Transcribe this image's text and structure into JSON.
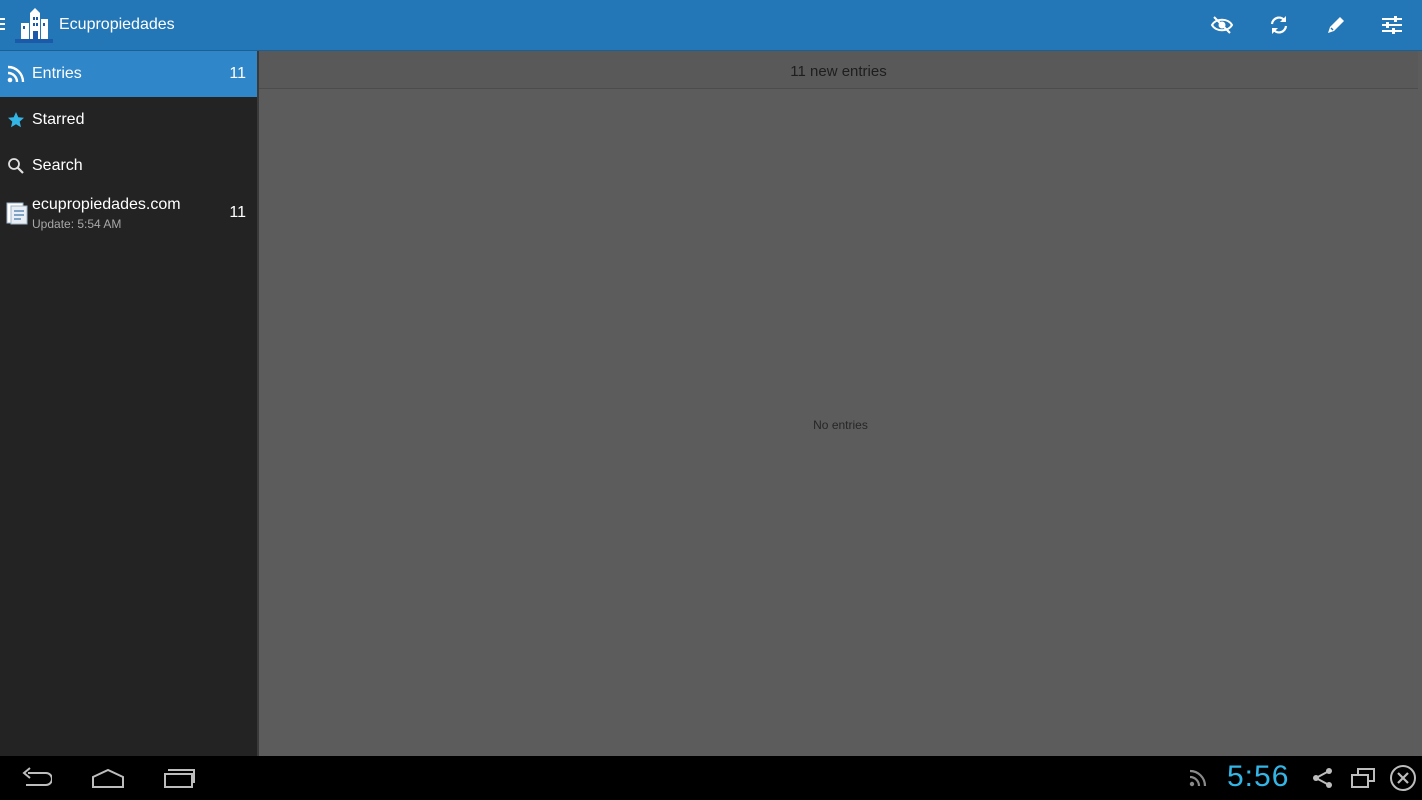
{
  "actionbar": {
    "title": "Ecupropiedades",
    "logo_icon": "building-logo-icon",
    "actions": [
      "hide-read-icon",
      "refresh-icon",
      "edit-icon",
      "settings-sliders-icon"
    ],
    "accent_color": "#2377b6"
  },
  "sidebar": {
    "items": [
      {
        "icon": "rss-icon",
        "label": "Entries",
        "count": "11",
        "active": true
      },
      {
        "icon": "star-icon",
        "label": "Starred",
        "count": ""
      },
      {
        "icon": "search-icon",
        "label": "Search",
        "count": ""
      }
    ],
    "feeds": [
      {
        "icon": "feed-document-icon",
        "title": "ecupropiedades.com",
        "subtitle": "Update: 5:54 AM",
        "count": "11"
      }
    ]
  },
  "main": {
    "new_entries": "11 new entries",
    "empty_text": "No entries"
  },
  "system_bar": {
    "buttons": [
      "back-icon",
      "home-icon",
      "recent-apps-icon"
    ],
    "status_icons": [
      "rss-status-icon",
      "share-icon",
      "window-icon",
      "close-circle-icon"
    ],
    "clock": "5:56",
    "clock_color": "#33b5e5"
  }
}
